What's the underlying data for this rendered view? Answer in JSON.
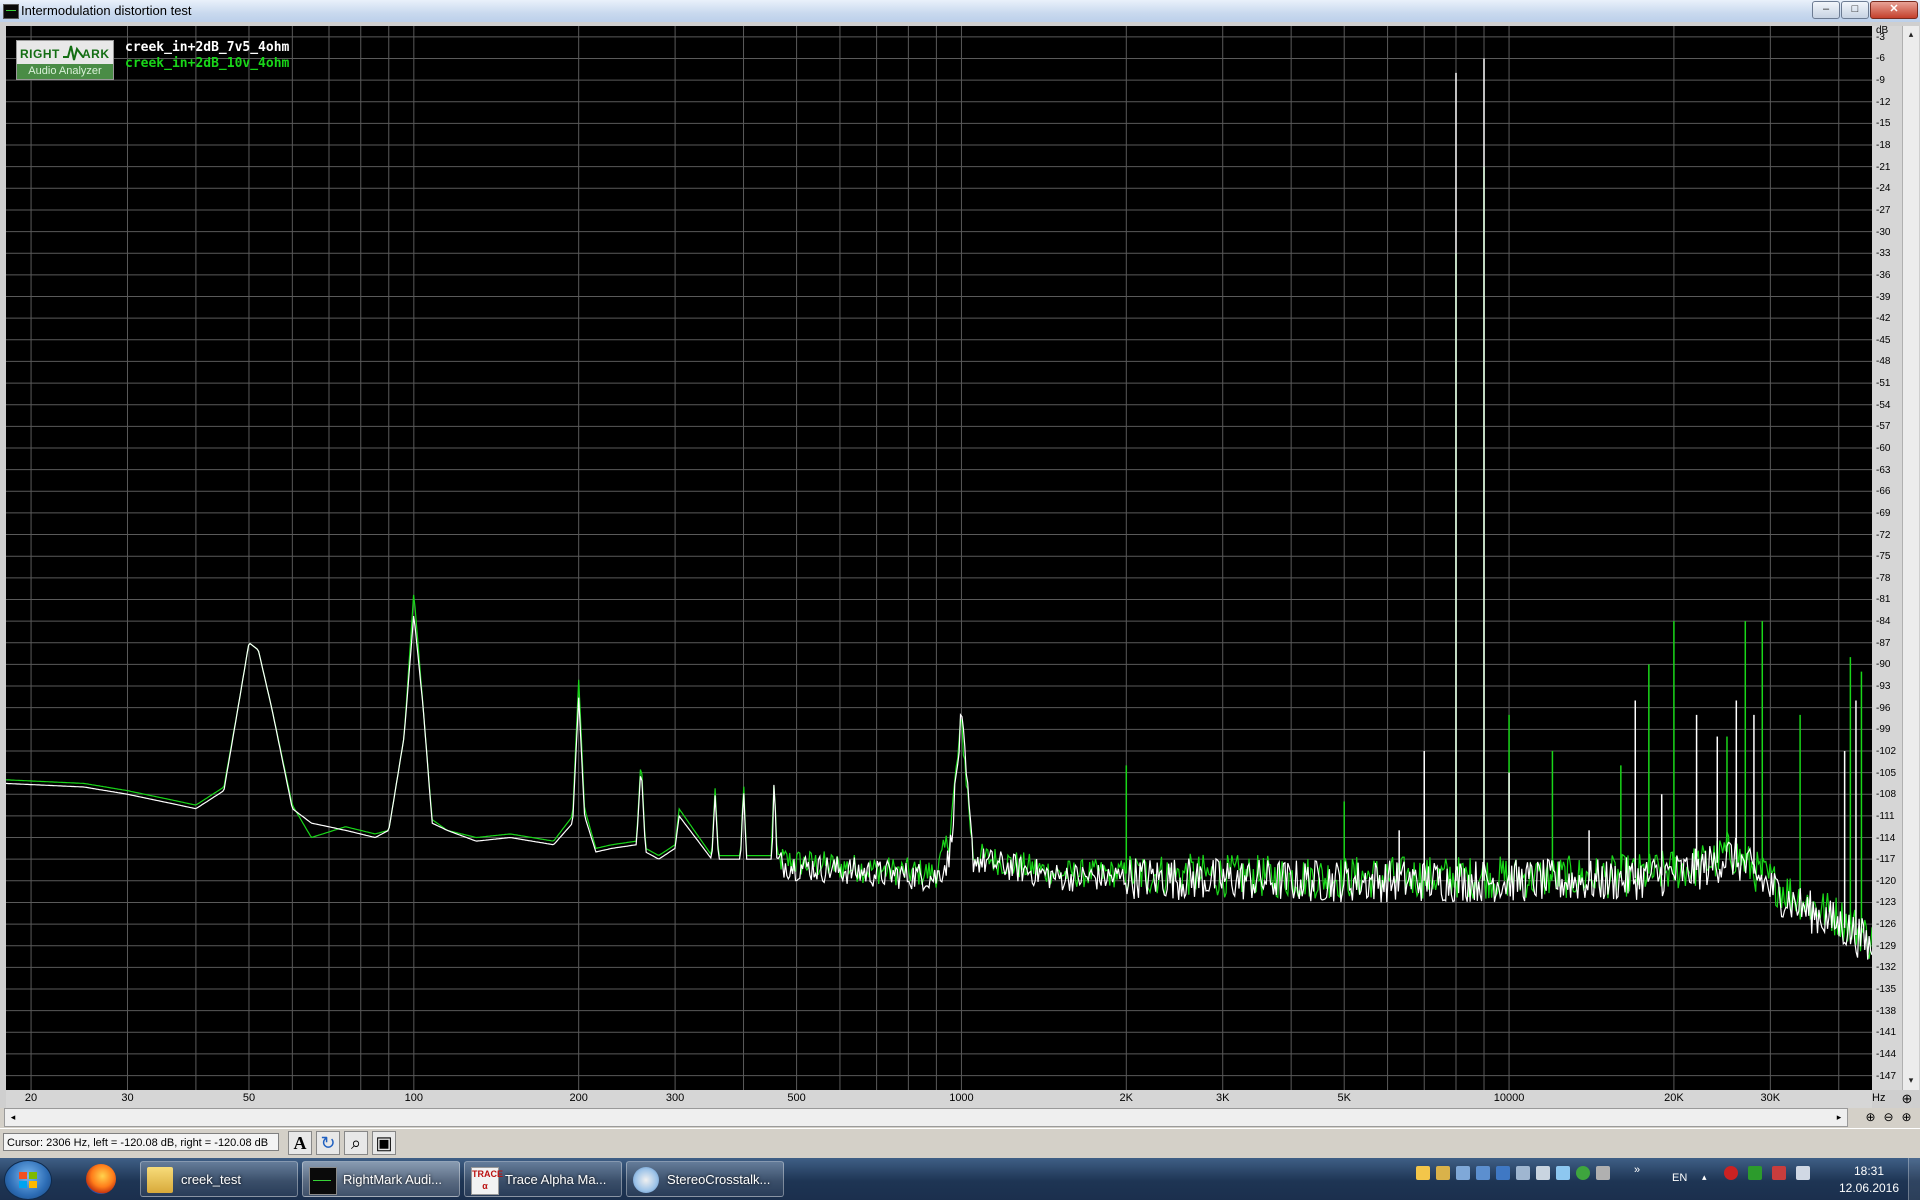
{
  "window": {
    "title": "Intermodulation distortion test",
    "min_glyph": "–",
    "max_glyph": "□",
    "close_glyph": "✕"
  },
  "logo": {
    "right": "RIGHT",
    "mark": "ARK",
    "subtitle": "Audio Analyzer"
  },
  "legend": [
    {
      "name": "creek_in+2dB_7v5_4ohm",
      "color": "#ffffff"
    },
    {
      "name": "creek_in+2dB_10v_4ohm",
      "color": "#19d619"
    }
  ],
  "chart_data": {
    "type": "line",
    "x_scale": "log",
    "xlim": [
      18,
      46000
    ],
    "ylim": [
      -149,
      -1.5
    ],
    "y_unit": "dB",
    "x_unit": "Hz",
    "grid": true,
    "x_major_ticks": [
      {
        "value": 20,
        "label": "20"
      },
      {
        "value": 30,
        "label": "30"
      },
      {
        "value": 50,
        "label": "50"
      },
      {
        "value": 100,
        "label": "100"
      },
      {
        "value": 200,
        "label": "200"
      },
      {
        "value": 300,
        "label": "300"
      },
      {
        "value": 500,
        "label": "500"
      },
      {
        "value": 1000,
        "label": "1000"
      },
      {
        "value": 2000,
        "label": "2K"
      },
      {
        "value": 3000,
        "label": "3K"
      },
      {
        "value": 5000,
        "label": "5K"
      },
      {
        "value": 10000,
        "label": "10000"
      },
      {
        "value": 20000,
        "label": "20K"
      },
      {
        "value": 30000,
        "label": "30K"
      }
    ],
    "x_minor_grid": [
      40,
      60,
      70,
      80,
      90,
      400,
      600,
      700,
      800,
      900,
      4000,
      6000,
      7000,
      8000,
      9000,
      40000
    ],
    "y_ticks": [
      -3,
      -6,
      -9,
      -12,
      -15,
      -18,
      -21,
      -24,
      -27,
      -30,
      -33,
      -36,
      -39,
      -42,
      -45,
      -48,
      -51,
      -54,
      -57,
      -60,
      -63,
      -66,
      -69,
      -72,
      -75,
      -78,
      -81,
      -84,
      -87,
      -90,
      -93,
      -96,
      -99,
      -102,
      -105,
      -108,
      -111,
      -114,
      -117,
      -120,
      -123,
      -126,
      -129,
      -132,
      -135,
      -138,
      -141,
      -144,
      -147
    ],
    "series": [
      {
        "name": "creek_in+2dB_7v5_4ohm",
        "color": "#ffffff",
        "x": [
          18,
          25,
          30,
          40,
          45,
          48,
          50,
          52,
          55,
          60,
          65,
          75,
          85,
          90,
          96,
          100,
          104,
          108,
          115,
          130,
          150,
          180,
          195,
          200,
          205,
          215,
          230,
          255,
          260,
          265,
          280,
          300,
          305,
          350,
          355,
          360,
          395,
          400,
          405,
          450,
          455,
          460,
          500,
          600,
          700,
          900,
          950,
          1000,
          1050,
          1500,
          2000,
          3000,
          4000,
          5000,
          6000,
          7000,
          8000,
          8500,
          9500,
          10000,
          12000,
          15000,
          18000,
          20000,
          22000,
          24000,
          25000,
          26000,
          27000,
          28000,
          30000,
          33000,
          36000,
          40000,
          44000,
          46000
        ],
        "y": [
          -106.5,
          -107,
          -108,
          -110,
          -107.5,
          -95,
          -87,
          -88,
          -96,
          -110,
          -112,
          -113,
          -114,
          -113,
          -100,
          -83,
          -96,
          -112,
          -113,
          -114.5,
          -114,
          -115,
          -112,
          -94.5,
          -111,
          -116,
          -115.5,
          -115,
          -104,
          -116,
          -117,
          -115.5,
          -111,
          -117,
          -108,
          -117,
          -117,
          -107,
          -117,
          -117,
          -106,
          -117.5,
          -118,
          -118.5,
          -119,
          -119.5,
          -117,
          -97.5,
          -117,
          -119.5,
          -119.5,
          -119.8,
          -120,
          -120,
          -120,
          -120,
          -120,
          -120,
          -120,
          -120,
          -120,
          -120,
          -119.5,
          -119,
          -118.5,
          -117.5,
          -116.5,
          -117,
          -118,
          -119,
          -121,
          -123,
          -124.5,
          -126,
          -128,
          -129.5
        ],
        "spikes": [
          {
            "f": 6300,
            "db": -113
          },
          {
            "f": 7000,
            "db": -102
          },
          {
            "f": 8000,
            "db": -8
          },
          {
            "f": 9000,
            "db": -6
          },
          {
            "f": 10000,
            "db": -105
          },
          {
            "f": 14000,
            "db": -113
          },
          {
            "f": 17000,
            "db": -95
          },
          {
            "f": 19000,
            "db": -108
          },
          {
            "f": 22000,
            "db": -97
          },
          {
            "f": 24000,
            "db": -100
          },
          {
            "f": 26000,
            "db": -95
          },
          {
            "f": 28000,
            "db": -97
          },
          {
            "f": 41000,
            "db": -102
          },
          {
            "f": 43000,
            "db": -95
          }
        ]
      },
      {
        "name": "creek_in+2dB_10v_4ohm",
        "color": "#19d619",
        "x": [
          18,
          25,
          30,
          40,
          45,
          48,
          50,
          52,
          55,
          60,
          65,
          75,
          85,
          90,
          96,
          100,
          104,
          108,
          115,
          130,
          150,
          180,
          195,
          200,
          205,
          215,
          230,
          255,
          260,
          265,
          280,
          300,
          305,
          350,
          355,
          360,
          395,
          400,
          405,
          450,
          455,
          460,
          500,
          600,
          700,
          900,
          950,
          1000,
          1050,
          1500,
          2000,
          3000,
          4000,
          5000,
          6000,
          7000,
          8000,
          8500,
          9500,
          10000,
          12000,
          15000,
          18000,
          20000,
          22000,
          24000,
          25000,
          26000,
          27000,
          28000,
          30000,
          33000,
          36000,
          40000,
          44000,
          46000
        ],
        "y": [
          -106,
          -106.5,
          -107.5,
          -109.5,
          -107,
          -95,
          -87,
          -88,
          -96,
          -109.5,
          -114,
          -112.5,
          -113.5,
          -113,
          -100,
          -80,
          -96,
          -111.5,
          -113,
          -114,
          -113.5,
          -114.5,
          -111,
          -92,
          -110,
          -115.5,
          -115,
          -114.5,
          -103,
          -115.5,
          -116.5,
          -115,
          -110,
          -116.5,
          -107,
          -116.5,
          -116.5,
          -106,
          -116.5,
          -116.5,
          -105,
          -117,
          -117.5,
          -118,
          -118.5,
          -119,
          -114,
          -98,
          -116.5,
          -119,
          -119,
          -119.3,
          -119.5,
          -119.5,
          -119.5,
          -119.5,
          -119.5,
          -119.5,
          -119.5,
          -119.5,
          -119.5,
          -119.5,
          -119,
          -118.5,
          -118,
          -117,
          -116,
          -116.5,
          -117.5,
          -118.5,
          -120,
          -122,
          -123.5,
          -125,
          -127,
          -128.5
        ],
        "spikes": [
          {
            "f": 2000,
            "db": -104
          },
          {
            "f": 5000,
            "db": -109
          },
          {
            "f": 8000,
            "db": -33
          },
          {
            "f": 9000,
            "db": -21
          },
          {
            "f": 10000,
            "db": -97
          },
          {
            "f": 12000,
            "db": -102
          },
          {
            "f": 16000,
            "db": -104
          },
          {
            "f": 18000,
            "db": -90
          },
          {
            "f": 20000,
            "db": -84
          },
          {
            "f": 25000,
            "db": -100
          },
          {
            "f": 27000,
            "db": -84
          },
          {
            "f": 29000,
            "db": -84
          },
          {
            "f": 34000,
            "db": -97
          },
          {
            "f": 42000,
            "db": -89
          },
          {
            "f": 44000,
            "db": -91
          }
        ]
      }
    ]
  },
  "cursor_readout": "Cursor:  2306 Hz,  left = -120.08 dB,  right = -120.08 dB",
  "toolbar": {
    "font_glyph": "A",
    "refresh_glyph": "↻",
    "zoom_glyph": "⌕",
    "save_glyph": "▣"
  },
  "scroll": {
    "left_glyph": "◂",
    "right_glyph": "▸",
    "up_glyph": "▴",
    "down_glyph": "▾"
  },
  "zoom_glyphs": {
    "zoom": "⊕",
    "zoom_in": "⊕",
    "zoom_out": "⊖",
    "zoom_fit": "⊕"
  },
  "taskbar": {
    "tasks": [
      {
        "label": "creek_test"
      },
      {
        "label": "RightMark Audi..."
      },
      {
        "label": "Trace Alpha Ma..."
      },
      {
        "label": "StereoCrosstalk..."
      }
    ],
    "trace_icon_text": "TRACE α",
    "tray_more": "»",
    "tray_arrow": "▴",
    "language": "EN",
    "time": "18:31",
    "date": "12.06.2016"
  }
}
